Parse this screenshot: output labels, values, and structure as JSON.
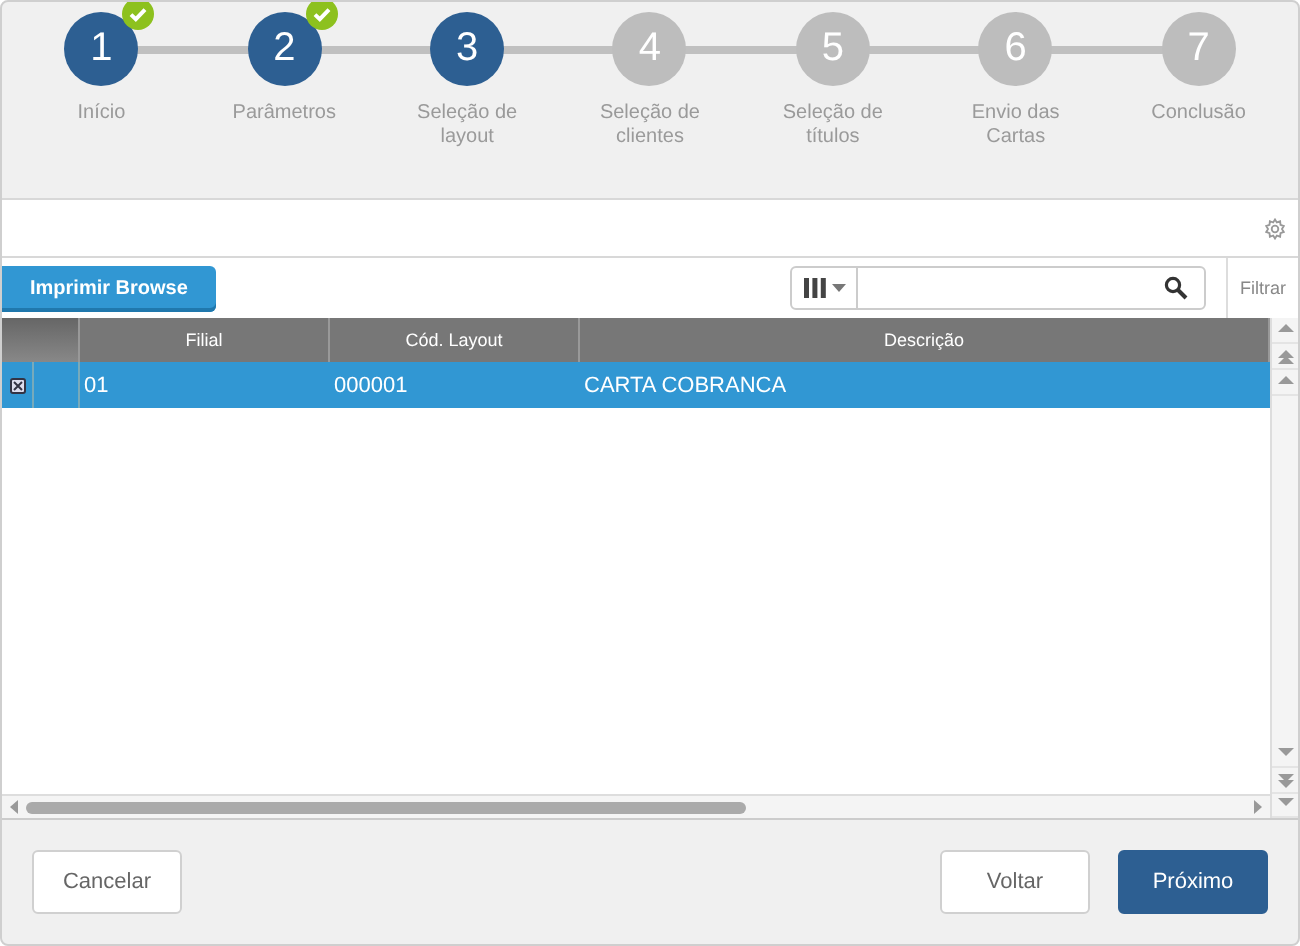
{
  "steps": [
    {
      "number": "1",
      "label": "Início",
      "completed": true,
      "reached": true
    },
    {
      "number": "2",
      "label": "Parâmetros",
      "completed": true,
      "reached": true
    },
    {
      "number": "3",
      "label": "Seleção de layout",
      "completed": false,
      "reached": true
    },
    {
      "number": "4",
      "label": "Seleção de clientes",
      "completed": false,
      "reached": false
    },
    {
      "number": "5",
      "label": "Seleção de títulos",
      "completed": false,
      "reached": false
    },
    {
      "number": "6",
      "label": "Envio das Cartas",
      "completed": false,
      "reached": false
    },
    {
      "number": "7",
      "label": "Conclusão",
      "completed": false,
      "reached": false
    }
  ],
  "toolbar": {
    "print_button": "Imprimir Browse",
    "filter_link": "Filtrar"
  },
  "table": {
    "columns": [
      "Filial",
      "Cód. Layout",
      "Descrição"
    ],
    "rows": [
      {
        "cells": [
          "01",
          "000001",
          "CARTA COBRANCA"
        ],
        "selected": true
      }
    ]
  },
  "footer": {
    "buttons": [
      {
        "label": "Cancelar",
        "kind": "secondary"
      },
      {
        "label": "Voltar",
        "kind": "secondary"
      },
      {
        "label": "Próximo",
        "kind": "primary"
      }
    ]
  }
}
